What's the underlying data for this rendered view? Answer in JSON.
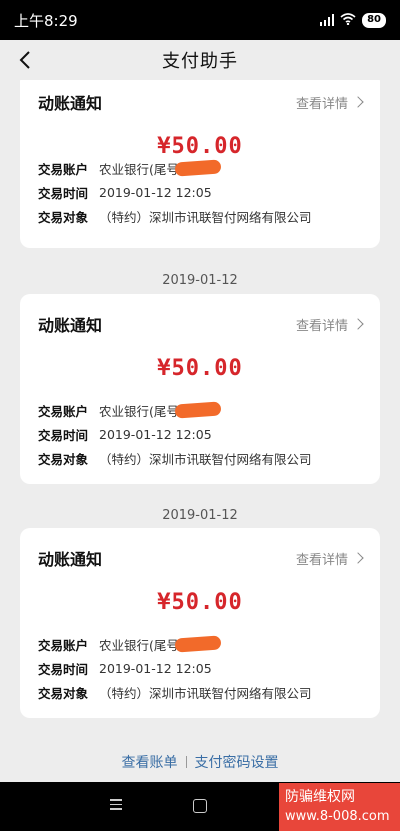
{
  "status_bar": {
    "time": "上午8:29",
    "battery": "80"
  },
  "nav": {
    "title": "支付助手"
  },
  "cards": [
    {
      "title": "动账通知",
      "detail_label": "查看详情",
      "amount": "¥50.00",
      "rows": [
        {
          "label": "交易账户",
          "value": "农业银行(尾号"
        },
        {
          "label": "交易时间",
          "value": "2019-01-12 12:05"
        },
        {
          "label": "交易对象",
          "value": "（特约）深圳市讯联智付网络有限公司"
        }
      ]
    },
    {
      "date": "2019-01-12",
      "title": "动账通知",
      "detail_label": "查看详情",
      "amount": "¥50.00",
      "rows": [
        {
          "label": "交易账户",
          "value": "农业银行(尾号"
        },
        {
          "label": "交易时间",
          "value": "2019-01-12 12:05"
        },
        {
          "label": "交易对象",
          "value": "（特约）深圳市讯联智付网络有限公司"
        }
      ]
    },
    {
      "date": "2019-01-12",
      "title": "动账通知",
      "detail_label": "查看详情",
      "amount": "¥50.00",
      "rows": [
        {
          "label": "交易账户",
          "value": "农业银行(尾号"
        },
        {
          "label": "交易时间",
          "value": "2019-01-12 12:05"
        },
        {
          "label": "交易对象",
          "value": "（特约）深圳市讯联智付网络有限公司"
        }
      ]
    }
  ],
  "footer": {
    "view_bill": "查看账单",
    "pay_password": "支付密码设置"
  },
  "watermark": {
    "name": "防骗维权网",
    "url": "www.8-008.com"
  },
  "colors": {
    "amount": "#d6262b",
    "link": "#3a6ea5",
    "redaction": "#f26a2a",
    "watermark_bg": "#e8463a"
  }
}
